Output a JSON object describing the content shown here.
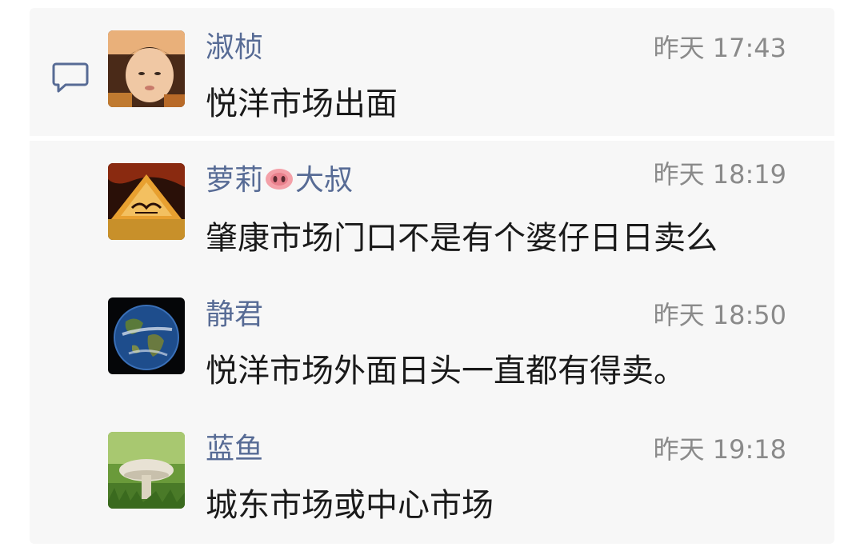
{
  "comments": [
    {
      "name": "淑桢",
      "time": "昨天 17:43",
      "text": "悦洋市场出面",
      "avatar": "child-photo-avatar"
    },
    {
      "name_prefix": "萝莉",
      "name_emoji": "pig-nose-emoji",
      "name_suffix": "大叔",
      "time": "昨天 18:19",
      "text": "肇康市场门口不是有个婆仔日日卖么",
      "avatar": "calligraphy-logo-avatar"
    },
    {
      "name": "静君",
      "time": "昨天 18:50",
      "text": "悦洋市场外面日头一直都有得卖。",
      "avatar": "earth-avatar"
    },
    {
      "name": "蓝鱼",
      "time": "昨天 19:18",
      "text": "城东市场或中心市场",
      "avatar": "mushroom-avatar"
    }
  ],
  "icons": {
    "comment": "comment-bubble-icon"
  },
  "colors": {
    "name": "#576b95",
    "time": "#8a8a8a",
    "text": "#1a1a1a",
    "panel": "#f7f7f7"
  }
}
